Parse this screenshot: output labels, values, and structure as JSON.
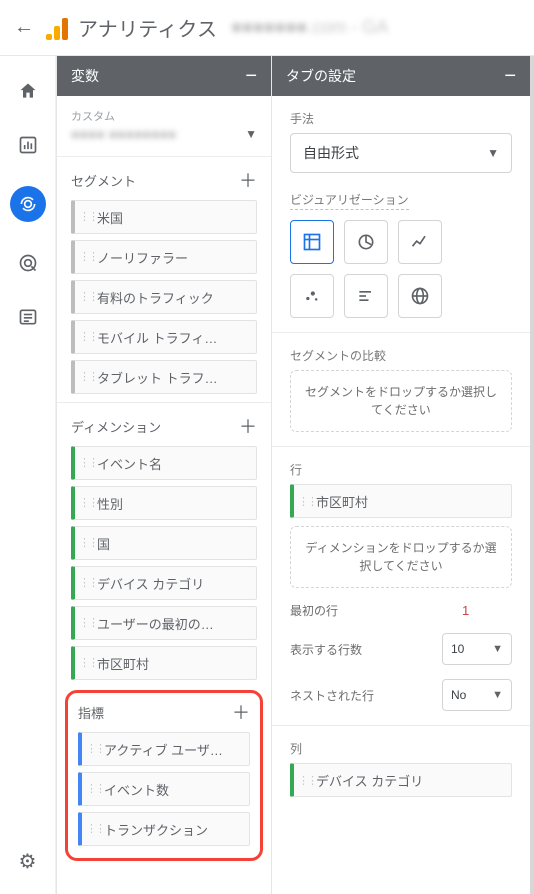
{
  "header": {
    "app_title": "アナリティクス",
    "sub_blur": "■■■■■■■.com - GA"
  },
  "rail": {
    "icons": [
      "home",
      "bar-chart",
      "explore",
      "target",
      "list"
    ],
    "active_index": 2
  },
  "variables_panel": {
    "title": "変数",
    "custom_label": "カスタム",
    "custom_value_blur": "■■■■ ■■■■■■■■",
    "sections": {
      "segment": {
        "label": "セグメント",
        "items": [
          "米国",
          "ノーリファラー",
          "有料のトラフィック",
          "モバイル トラフィ…",
          "タブレット トラフ…"
        ]
      },
      "dimension": {
        "label": "ディメンション",
        "items": [
          "イベント名",
          "性別",
          "国",
          "デバイス カテゴリ",
          "ユーザーの最初の…",
          "市区町村"
        ]
      },
      "metric": {
        "label": "指標",
        "items": [
          "アクティブ ユーザ…",
          "イベント数",
          "トランザクション"
        ]
      }
    }
  },
  "tab_settings": {
    "title": "タブの設定",
    "method_label": "手法",
    "method_value": "自由形式",
    "visualization_label": "ビジュアリゼーション",
    "viz_icons": [
      "table",
      "donut",
      "line",
      "scatter",
      "bar-h",
      "globe"
    ],
    "viz_active": 0,
    "segment_compare_label": "セグメントの比較",
    "segment_drop_hint": "セグメントをドロップするか選択してください",
    "rows_label": "行",
    "row_chip": "市区町村",
    "row_drop_hint": "ディメンションをドロップするか選択してください",
    "first_row_label": "最初の行",
    "first_row_value": "1",
    "show_rows_label": "表示する行数",
    "show_rows_value": "10",
    "nested_rows_label": "ネストされた行",
    "nested_rows_value": "No",
    "cols_label": "列",
    "col_chip": "デバイス カテゴリ"
  }
}
